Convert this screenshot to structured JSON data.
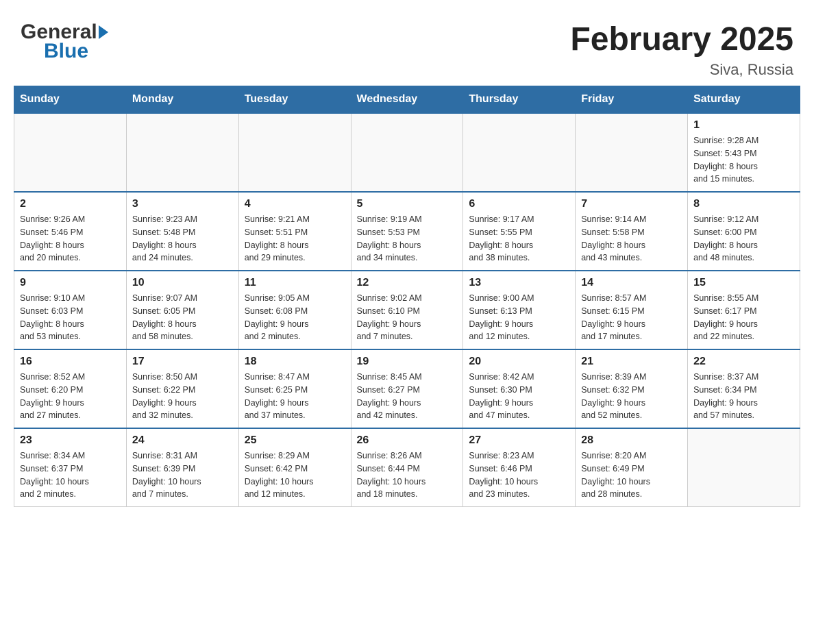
{
  "header": {
    "logo_general": "General",
    "logo_blue": "Blue",
    "title": "February 2025",
    "subtitle": "Siva, Russia"
  },
  "weekdays": [
    "Sunday",
    "Monday",
    "Tuesday",
    "Wednesday",
    "Thursday",
    "Friday",
    "Saturday"
  ],
  "weeks": [
    [
      {
        "day": "",
        "info": ""
      },
      {
        "day": "",
        "info": ""
      },
      {
        "day": "",
        "info": ""
      },
      {
        "day": "",
        "info": ""
      },
      {
        "day": "",
        "info": ""
      },
      {
        "day": "",
        "info": ""
      },
      {
        "day": "1",
        "info": "Sunrise: 9:28 AM\nSunset: 5:43 PM\nDaylight: 8 hours\nand 15 minutes."
      }
    ],
    [
      {
        "day": "2",
        "info": "Sunrise: 9:26 AM\nSunset: 5:46 PM\nDaylight: 8 hours\nand 20 minutes."
      },
      {
        "day": "3",
        "info": "Sunrise: 9:23 AM\nSunset: 5:48 PM\nDaylight: 8 hours\nand 24 minutes."
      },
      {
        "day": "4",
        "info": "Sunrise: 9:21 AM\nSunset: 5:51 PM\nDaylight: 8 hours\nand 29 minutes."
      },
      {
        "day": "5",
        "info": "Sunrise: 9:19 AM\nSunset: 5:53 PM\nDaylight: 8 hours\nand 34 minutes."
      },
      {
        "day": "6",
        "info": "Sunrise: 9:17 AM\nSunset: 5:55 PM\nDaylight: 8 hours\nand 38 minutes."
      },
      {
        "day": "7",
        "info": "Sunrise: 9:14 AM\nSunset: 5:58 PM\nDaylight: 8 hours\nand 43 minutes."
      },
      {
        "day": "8",
        "info": "Sunrise: 9:12 AM\nSunset: 6:00 PM\nDaylight: 8 hours\nand 48 minutes."
      }
    ],
    [
      {
        "day": "9",
        "info": "Sunrise: 9:10 AM\nSunset: 6:03 PM\nDaylight: 8 hours\nand 53 minutes."
      },
      {
        "day": "10",
        "info": "Sunrise: 9:07 AM\nSunset: 6:05 PM\nDaylight: 8 hours\nand 58 minutes."
      },
      {
        "day": "11",
        "info": "Sunrise: 9:05 AM\nSunset: 6:08 PM\nDaylight: 9 hours\nand 2 minutes."
      },
      {
        "day": "12",
        "info": "Sunrise: 9:02 AM\nSunset: 6:10 PM\nDaylight: 9 hours\nand 7 minutes."
      },
      {
        "day": "13",
        "info": "Sunrise: 9:00 AM\nSunset: 6:13 PM\nDaylight: 9 hours\nand 12 minutes."
      },
      {
        "day": "14",
        "info": "Sunrise: 8:57 AM\nSunset: 6:15 PM\nDaylight: 9 hours\nand 17 minutes."
      },
      {
        "day": "15",
        "info": "Sunrise: 8:55 AM\nSunset: 6:17 PM\nDaylight: 9 hours\nand 22 minutes."
      }
    ],
    [
      {
        "day": "16",
        "info": "Sunrise: 8:52 AM\nSunset: 6:20 PM\nDaylight: 9 hours\nand 27 minutes."
      },
      {
        "day": "17",
        "info": "Sunrise: 8:50 AM\nSunset: 6:22 PM\nDaylight: 9 hours\nand 32 minutes."
      },
      {
        "day": "18",
        "info": "Sunrise: 8:47 AM\nSunset: 6:25 PM\nDaylight: 9 hours\nand 37 minutes."
      },
      {
        "day": "19",
        "info": "Sunrise: 8:45 AM\nSunset: 6:27 PM\nDaylight: 9 hours\nand 42 minutes."
      },
      {
        "day": "20",
        "info": "Sunrise: 8:42 AM\nSunset: 6:30 PM\nDaylight: 9 hours\nand 47 minutes."
      },
      {
        "day": "21",
        "info": "Sunrise: 8:39 AM\nSunset: 6:32 PM\nDaylight: 9 hours\nand 52 minutes."
      },
      {
        "day": "22",
        "info": "Sunrise: 8:37 AM\nSunset: 6:34 PM\nDaylight: 9 hours\nand 57 minutes."
      }
    ],
    [
      {
        "day": "23",
        "info": "Sunrise: 8:34 AM\nSunset: 6:37 PM\nDaylight: 10 hours\nand 2 minutes."
      },
      {
        "day": "24",
        "info": "Sunrise: 8:31 AM\nSunset: 6:39 PM\nDaylight: 10 hours\nand 7 minutes."
      },
      {
        "day": "25",
        "info": "Sunrise: 8:29 AM\nSunset: 6:42 PM\nDaylight: 10 hours\nand 12 minutes."
      },
      {
        "day": "26",
        "info": "Sunrise: 8:26 AM\nSunset: 6:44 PM\nDaylight: 10 hours\nand 18 minutes."
      },
      {
        "day": "27",
        "info": "Sunrise: 8:23 AM\nSunset: 6:46 PM\nDaylight: 10 hours\nand 23 minutes."
      },
      {
        "day": "28",
        "info": "Sunrise: 8:20 AM\nSunset: 6:49 PM\nDaylight: 10 hours\nand 28 minutes."
      },
      {
        "day": "",
        "info": ""
      }
    ]
  ]
}
